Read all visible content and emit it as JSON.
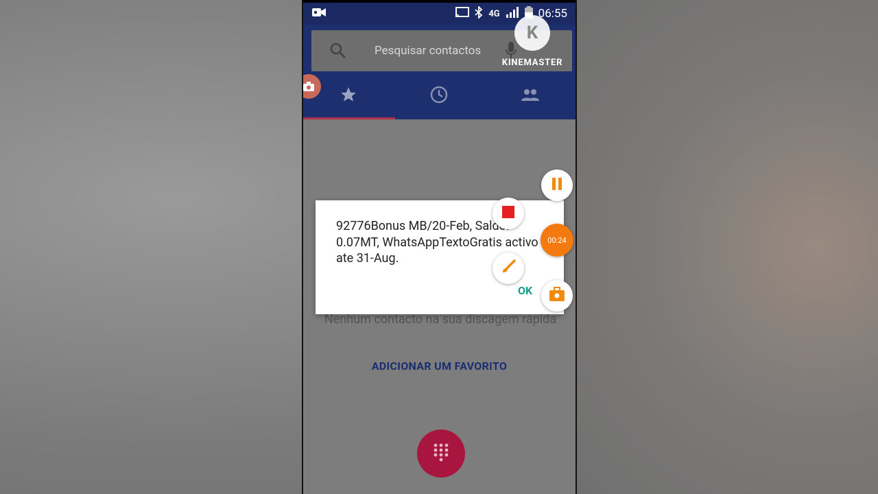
{
  "status_bar": {
    "network": "4G",
    "time": "06:55"
  },
  "search": {
    "placeholder": "Pesquisar contactos"
  },
  "tabs": [
    {
      "icon": "star-icon",
      "active": true
    },
    {
      "icon": "clock-icon",
      "active": false
    },
    {
      "icon": "people-icon",
      "active": false
    }
  ],
  "main": {
    "empty_message": "Nenhum contacto na sua discagem rápida",
    "add_favorite": "ADICIONAR UM FAVORITO"
  },
  "dialog": {
    "message": "92776Bonus MB/20-Feb, Saldo: 0.07MT, WhatsAppTextoGratis activo ate 31-Aug.",
    "ok_label": "OK"
  },
  "watermark": {
    "logo_letter": "K",
    "name": "KINEMASTER"
  },
  "recorder": {
    "timer": "00:24"
  },
  "colors": {
    "statusbar": "#1b2a63",
    "appbar": "#1d2f6e",
    "fab": "#a8153f",
    "ok": "#1a9a8a",
    "recorder_orange": "#f47a10"
  }
}
